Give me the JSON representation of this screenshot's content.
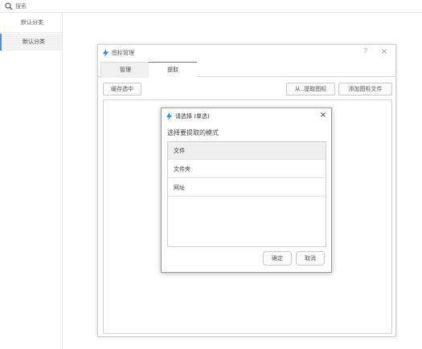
{
  "search": {
    "placeholder": "搜索"
  },
  "categories": [
    {
      "label": "默认分类"
    },
    {
      "label": "默认分类"
    }
  ],
  "main_window": {
    "title": "图标管理",
    "help_label": "?",
    "close_label": "×",
    "tabs": [
      {
        "label": "管理"
      },
      {
        "label": "提取"
      }
    ],
    "buttons": {
      "cache_selected": "缓存选中",
      "extract_from": "从..提取图标",
      "add_icon_file": "添加图标文件"
    }
  },
  "choose_dialog": {
    "title": "请选择 (单选)",
    "close_label": "×",
    "prompt": "选择要提取的模式",
    "options": [
      {
        "label": "文件"
      },
      {
        "label": "文件夹"
      },
      {
        "label": "网址"
      }
    ],
    "selected_index": 0,
    "confirm_label": "确定",
    "cancel_label": "取消"
  },
  "colors": {
    "accent": "#3a7fd8",
    "bolt_icon": "#2b8be0",
    "selected_bg": "#efefef"
  },
  "icons": {
    "search": "search-icon",
    "bolt": "bolt-icon",
    "close": "close-icon"
  }
}
